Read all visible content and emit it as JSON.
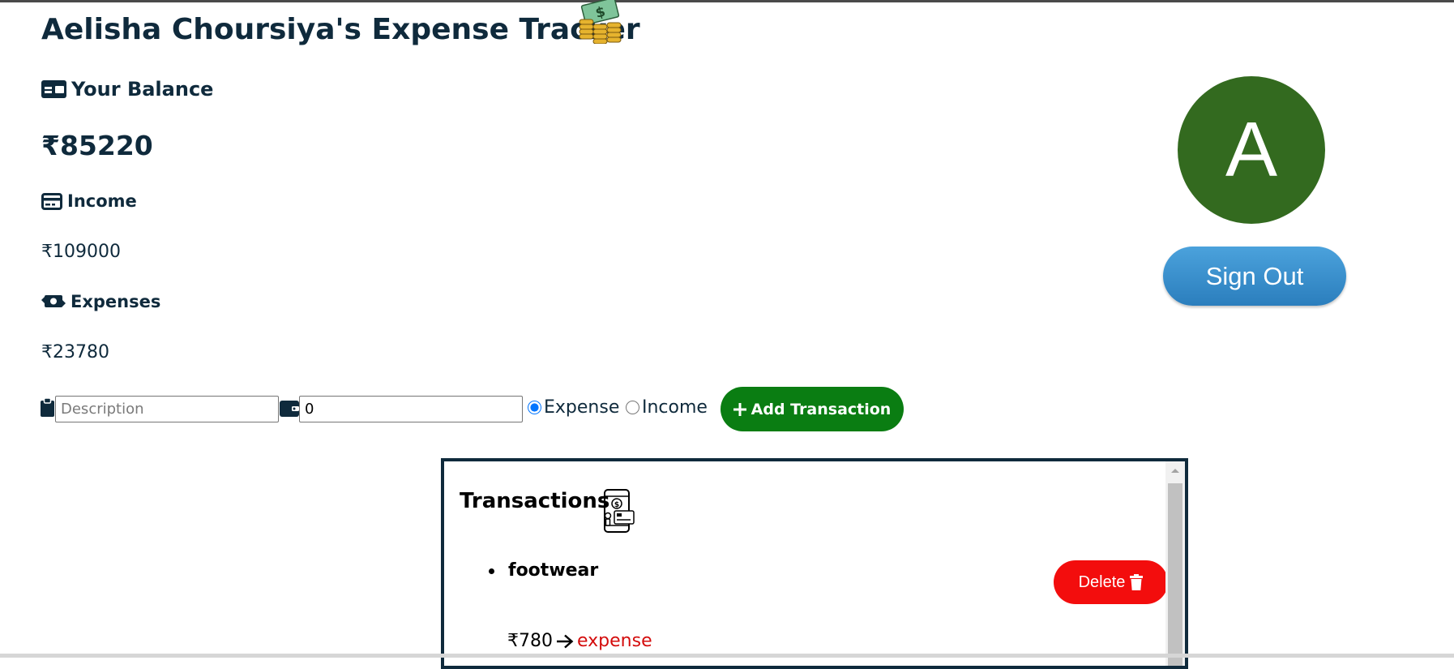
{
  "header": {
    "title": "Aelisha Choursiya's Expense Tracker"
  },
  "summary": {
    "balance_label": "Your Balance",
    "balance_value": "₹85220",
    "income_label": "Income",
    "income_value": "₹109000",
    "expenses_label": "Expenses",
    "expenses_value": "₹23780"
  },
  "user": {
    "avatar_letter": "A",
    "avatar_color": "#336a1f",
    "sign_out_label": "Sign Out"
  },
  "form": {
    "description_placeholder": "Description",
    "amount_value": "0",
    "type_options": [
      "Expense",
      "Income"
    ],
    "selected_type": "Expense",
    "add_button_label": "Add Transaction"
  },
  "transactions": {
    "title": "Transactions",
    "items": [
      {
        "name": "footwear",
        "amount": "₹780",
        "type": "expense",
        "delete_label": "Delete"
      }
    ]
  },
  "icons": {
    "header": "money-coins-icon",
    "balance": "wallet-card-icon",
    "income": "credit-card-icon",
    "expenses": "money-exchange-icon",
    "description": "clipboard-icon",
    "amount": "wallet-icon",
    "add": "plus-icon",
    "delete": "trash-icon",
    "transactions": "mobile-payment-icon",
    "arrow": "arrow-right-icon"
  },
  "colors": {
    "text": "#0f2a3c",
    "add_button": "#0a7d12",
    "delete_button": "#f30d0d",
    "sign_out_button": "#2b7ebd",
    "expense_text": "#d40c0c"
  }
}
